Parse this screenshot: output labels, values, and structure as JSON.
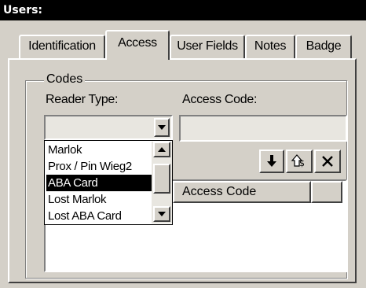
{
  "window": {
    "title": "Users:"
  },
  "tabs": [
    {
      "label": "Identification"
    },
    {
      "label": "Access"
    },
    {
      "label": "User Fields"
    },
    {
      "label": "Notes"
    },
    {
      "label": "Badge"
    }
  ],
  "codes_group": {
    "label": "Codes",
    "reader_type_label": "Reader Type:",
    "access_code_label": "Access Code:",
    "reader_type_value": "",
    "access_code_value": ""
  },
  "dropdown": {
    "options": [
      "Marlok",
      "Prox / Pin Wieg2",
      "ABA Card",
      "Lost Marlok",
      "Lost ABA Card"
    ],
    "selected": "ABA Card"
  },
  "grid": {
    "columns": [
      "",
      "Access Code",
      ""
    ]
  },
  "toolbar": {
    "add_icon": "down-arrow-icon",
    "update_icon": "up-arrow-icon",
    "delete_icon": "x-icon"
  }
}
